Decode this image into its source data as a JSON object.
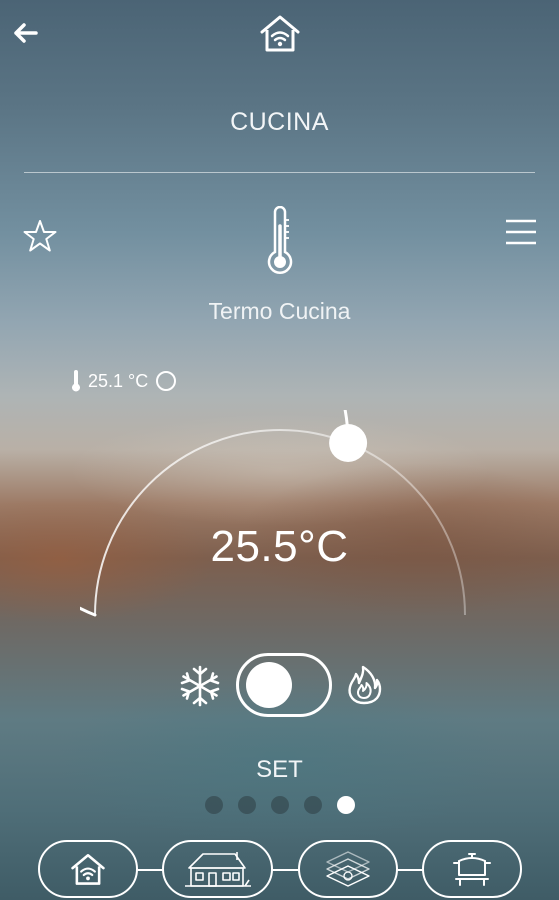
{
  "header": {
    "back_icon": "arrow-left-icon",
    "home_icon": "smart-home-icon",
    "room_title": "CUCINA"
  },
  "device": {
    "favorite_icon": "star-icon",
    "menu_icon": "hamburger-menu-icon",
    "device_icon": "thermometer-icon",
    "name": "Termo Cucina"
  },
  "thermostat": {
    "current_temperature": "25.1 °C",
    "set_temperature": "25.5°C",
    "dial_level": 0.62,
    "mode_cool_icon": "snowflake-icon",
    "mode_heat_icon": "flame-icon",
    "mode_toggle_state": "cool",
    "set_label": "SET"
  },
  "pagination": {
    "count": 5,
    "active_index": 4
  },
  "bottom_nav": {
    "items": [
      {
        "icon": "smart-home-icon"
      },
      {
        "icon": "house-building-icon"
      },
      {
        "icon": "floor-layers-icon"
      },
      {
        "icon": "cooking-pot-icon"
      }
    ]
  },
  "colors": {
    "foreground": "#ffffff",
    "dot_inactive": "#3a4347"
  }
}
